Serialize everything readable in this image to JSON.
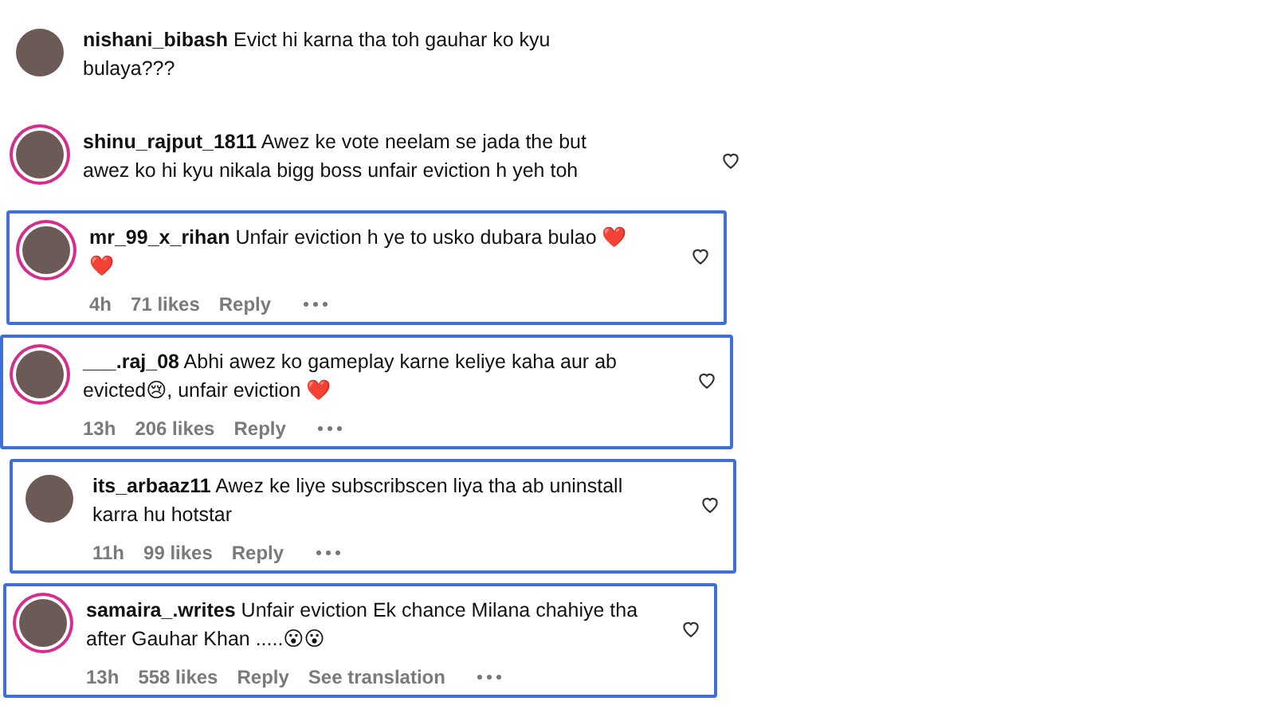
{
  "comments": [
    {
      "username": "nishani_bibash",
      "text": "Evict hi karna tha toh gauhar ko kyu bulaya???",
      "story_ring": false,
      "highlighted": false,
      "like_button": false
    },
    {
      "username": "shinu_rajput_1811",
      "text": "Awez ke vote neelam se jada the but awez ko hi kyu nikala bigg boss unfair eviction h yeh toh",
      "story_ring": true,
      "highlighted": false,
      "like_button": true
    },
    {
      "username": "mr_99_x_rihan",
      "text": "Unfair eviction h ye to usko dubara bulao ❤️ ❤️",
      "story_ring": true,
      "highlighted": true,
      "like_button": true,
      "meta": [
        "4h",
        "71 likes",
        "Reply"
      ]
    },
    {
      "username": "___.raj_08",
      "text": "Abhi awez ko gameplay karne keliye kaha aur ab evicted😢, unfair eviction ❤️",
      "story_ring": true,
      "highlighted": true,
      "like_button": true,
      "meta": [
        "13h",
        "206 likes",
        "Reply"
      ]
    },
    {
      "username": "its_arbaaz11",
      "text": "Awez ke liye subscribscen liya tha ab uninstall karra hu hotstar",
      "story_ring": false,
      "highlighted": true,
      "like_button": true,
      "meta": [
        "11h",
        "99 likes",
        "Reply"
      ]
    },
    {
      "username": "samaira_.writes",
      "text": "Unfair eviction Ek chance Milana chahiye tha after Gauhar Khan .....😮😮",
      "story_ring": true,
      "highlighted": true,
      "like_button": true,
      "meta": [
        "13h",
        "558 likes",
        "Reply",
        "See translation"
      ]
    }
  ]
}
